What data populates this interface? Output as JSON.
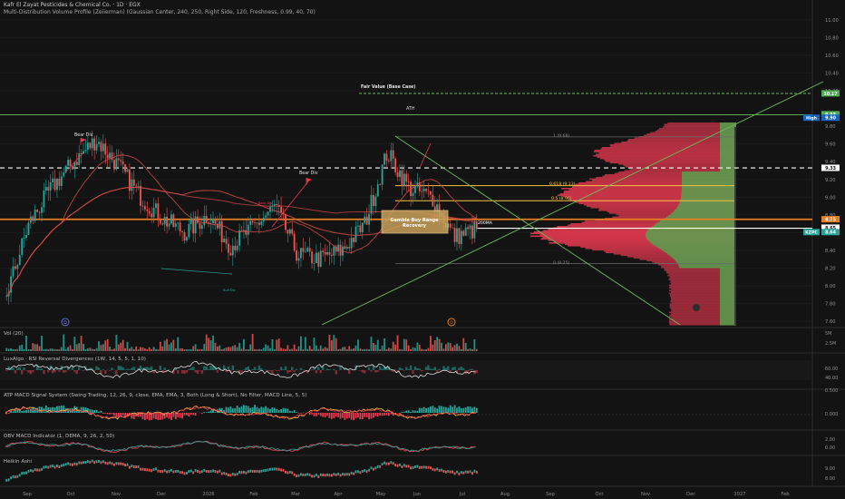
{
  "header": {
    "title": "Kafr El Zayat Pesticides & Chemical Co. · 1D · EGX",
    "indicator": "Multi-Distribution Volume Profile (Zeiierman) (Gaussian Center, 240, 250, Right Side, 120, Freshness, 0.99, 40, 70)"
  },
  "panes": [
    {
      "key": "vol",
      "label": "Vol (20)"
    },
    {
      "key": "rsi",
      "label": "LuxAlgo · RSI Reversal Divergences (1W, 14, 5, 5, 1, 10)"
    },
    {
      "key": "macd",
      "label": "ATP MACD Signal System (Swing Trading, 12, 26, 9, close, EMA, EMA, 3, Both (Long & Short), No Filter, MACD Line, 5, 5)"
    },
    {
      "key": "obv",
      "label": "OBV MACD Indicator (1, DEMA, 9, 26, 2, 50)"
    },
    {
      "key": "ha",
      "label": "Heikin Ashi"
    }
  ],
  "price_axis": {
    "ticks": [
      "11.00",
      "10.80",
      "10.60",
      "10.40",
      "10.20",
      "9.80",
      "9.60",
      "9.40",
      "9.20",
      "9.00",
      "8.80",
      "8.60",
      "8.40",
      "8.20",
      "8.00",
      "7.80",
      "7.60"
    ],
    "tags": [
      {
        "text": "10.17",
        "value": 10.17,
        "color": "#4caf50"
      },
      {
        "text": "9.93",
        "value": 9.935,
        "color": "#4caf50"
      },
      {
        "text": "High",
        "value": 9.895,
        "color": "#1565c0",
        "prefix": true
      },
      {
        "text": "9.90",
        "value": 9.895,
        "color": "#1565c0"
      },
      {
        "text": "9.33",
        "value": 9.33,
        "color": "#ffffff",
        "dark": true
      },
      {
        "text": "8.75",
        "value": 8.75,
        "color": "#e67e22"
      },
      {
        "text": "8.65",
        "value": 8.655,
        "color": "#ffffff",
        "dark": true
      },
      {
        "text": "KZPC",
        "value": 8.605,
        "color": "#26a69a",
        "prefix": true
      },
      {
        "text": "8.64",
        "value": 8.605,
        "color": "#26a69a"
      }
    ]
  },
  "pane_axis": {
    "vol": [
      "5M",
      "2.5M"
    ],
    "rsi": [
      "60.00",
      "40.00"
    ],
    "macd": [
      "0.500",
      "0.000"
    ],
    "obv": [
      "2.00",
      "0.00"
    ],
    "ha": [
      "9.00",
      "8.00"
    ]
  },
  "time_axis": [
    "Sep",
    "Oct",
    "Nov",
    "Dec",
    "2026",
    "Feb",
    "Mar",
    "Apr",
    "May",
    "Jun",
    "Jul",
    "Aug",
    "Sep",
    "Oct",
    "Nov",
    "Dec",
    "2027",
    "Feb"
  ],
  "annotations": {
    "fair_value": "Fair Value (Base Case)",
    "ath": "ATH",
    "bear_div_1": "Bear Div",
    "bear_div_2": "Bear Div",
    "bear_div_small": "Bear Div",
    "bull_div": "Bull Div",
    "ma200": "200MA",
    "fib_1": "1 (9.68)",
    "fib_0618": "0.618 (9.13)",
    "fib_05": "0.5 (8.96)",
    "fib_0": "0 (8.25)",
    "box_line1": "Gamble Buy Range",
    "box_line2": "Recovery",
    "event_1": "D",
    "event_2": "D"
  },
  "colors": {
    "bg": "#131313",
    "up": "#26a69a",
    "down": "#ef5350",
    "orange": "#e67e22",
    "fib": "#f5c242",
    "green_line": "#6dbb5a",
    "white": "#ffffff",
    "vol_green": "#4caf50",
    "vol_red": "#e53950"
  },
  "chart_data": {
    "type": "candlestick",
    "symbol": "KZPC",
    "timeframe": "1D",
    "last_price": 8.64,
    "key_levels": {
      "fair_value": 10.17,
      "ath": 9.93,
      "high": 9.9,
      "resistance": 9.33,
      "orange_level": 8.75,
      "ma_level": 8.65,
      "fib_1": 9.68,
      "fib_0618": 9.13,
      "fib_05": 8.96,
      "fib_0": 8.25
    },
    "ylim": [
      7.55,
      11.05
    ],
    "approx_close_path": [
      {
        "t": "Sep",
        "v": 7.9
      },
      {
        "t": "Sep",
        "v": 8.7
      },
      {
        "t": "Oct",
        "v": 9.1
      },
      {
        "t": "Oct",
        "v": 9.4
      },
      {
        "t": "Nov",
        "v": 9.65
      },
      {
        "t": "Nov",
        "v": 9.35
      },
      {
        "t": "Dec",
        "v": 9.0
      },
      {
        "t": "Dec",
        "v": 8.75
      },
      {
        "t": "2026",
        "v": 8.6
      },
      {
        "t": "2026",
        "v": 8.8
      },
      {
        "t": "Feb",
        "v": 8.45
      },
      {
        "t": "Feb",
        "v": 8.65
      },
      {
        "t": "Mar",
        "v": 8.9
      },
      {
        "t": "Mar",
        "v": 8.35
      },
      {
        "t": "Apr",
        "v": 8.3
      },
      {
        "t": "Apr",
        "v": 8.4
      },
      {
        "t": "May",
        "v": 8.7
      },
      {
        "t": "May",
        "v": 9.5
      },
      {
        "t": "Jun",
        "v": 9.1
      },
      {
        "t": "Jun",
        "v": 9.0
      },
      {
        "t": "Jul",
        "v": 8.55
      },
      {
        "t": "Jul",
        "v": 8.64
      }
    ]
  }
}
